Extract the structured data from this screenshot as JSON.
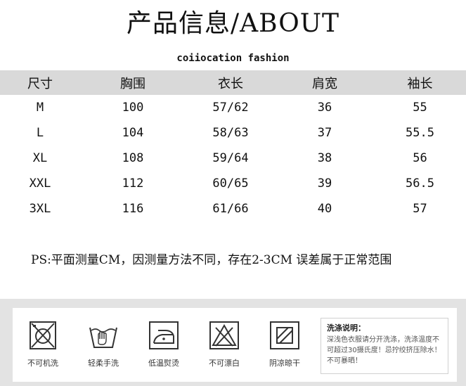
{
  "header": {
    "title": "产品信息/ABOUT",
    "subtitle": "coiiocation fashion"
  },
  "size_table": {
    "columns": [
      "尺寸",
      "胸围",
      "衣长",
      "肩宽",
      "袖长"
    ],
    "rows": [
      [
        "M",
        "100",
        "57/62",
        "36",
        "55"
      ],
      [
        "L",
        "104",
        "58/63",
        "37",
        "55.5"
      ],
      [
        "XL",
        "108",
        "59/64",
        "38",
        "56"
      ],
      [
        "XXL",
        "112",
        "60/65",
        "39",
        "56.5"
      ],
      [
        "3XL",
        "116",
        "61/66",
        "40",
        "57"
      ]
    ]
  },
  "note": "PS:平面测量CM，因测量方法不同，存在2-3CM 误差属于正常范围",
  "care": {
    "items": [
      {
        "icon": "no-machine-wash-icon",
        "label": "不可机洗"
      },
      {
        "icon": "hand-wash-icon",
        "label": "轻柔手洗"
      },
      {
        "icon": "low-temp-iron-icon",
        "label": "低温熨烫"
      },
      {
        "icon": "no-bleach-icon",
        "label": "不可漂白"
      },
      {
        "icon": "dry-in-shade-icon",
        "label": "阴凉晾干"
      }
    ],
    "instructions": {
      "title": "洗涤说明：",
      "text": "深浅色衣服请分开洗涤，洗涤温度不可超过30摄氏度！忌拧绞挤压除水！不可暴晒！"
    }
  }
}
